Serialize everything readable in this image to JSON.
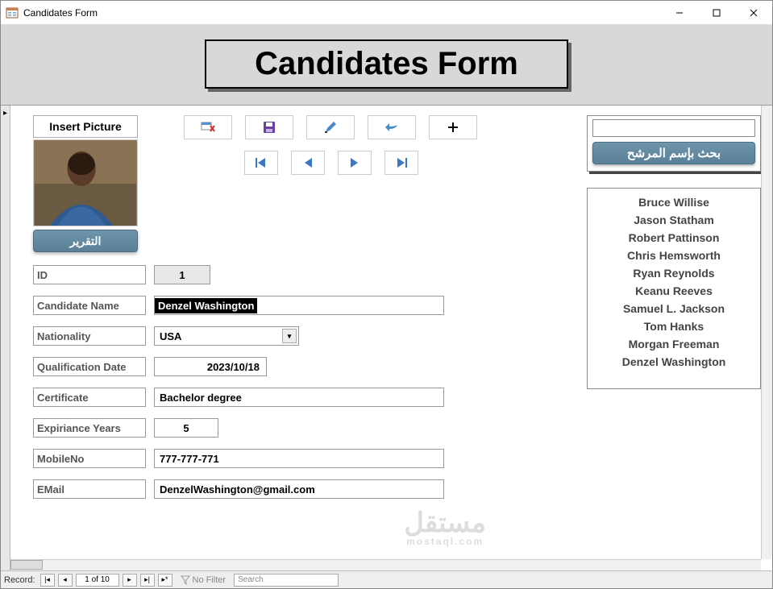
{
  "window": {
    "title": "Candidates Form"
  },
  "header": {
    "title": "Candidates Form"
  },
  "buttons": {
    "insertPicture": "Insert Picture",
    "report_ar": "التقرير",
    "searchByName_ar": "بحث بإسم المرشح"
  },
  "toolbar": {
    "icons": [
      "toggle-icon",
      "save-icon",
      "edit-icon",
      "undo-icon",
      "add-icon"
    ]
  },
  "nav": {
    "first": "|◀",
    "prev": "◀",
    "next": "▶",
    "last": "▶|"
  },
  "form": {
    "labels": {
      "id": "ID",
      "name": "Candidate Name",
      "nationality": "Nationality",
      "qualDate": "Qualification Date",
      "certificate": "Certificate",
      "expYears": "Expiriance Years",
      "mobile": "MobileNo",
      "email": "EMail"
    },
    "values": {
      "id": "1",
      "name": "Denzel Washington",
      "nationality": "USA",
      "qualDate": "2023/10/18",
      "certificate": "Bachelor degree",
      "expYears": "5",
      "mobile": "777-777-771",
      "email": "DenzelWashington@gmail.com"
    }
  },
  "candidatesList": [
    "Bruce Willise",
    "Jason Statham",
    "Robert Pattinson",
    "Chris Hemsworth",
    "Ryan Reynolds",
    "Keanu Reeves",
    "Samuel L. Jackson",
    "Tom Hanks",
    "Morgan Freeman",
    "Denzel Washington"
  ],
  "watermark": {
    "main": "مستقل",
    "sub": "mostaql.com"
  },
  "recordBar": {
    "label": "Record:",
    "position": "1 of 10",
    "noFilter": "No Filter",
    "search": "Search"
  }
}
